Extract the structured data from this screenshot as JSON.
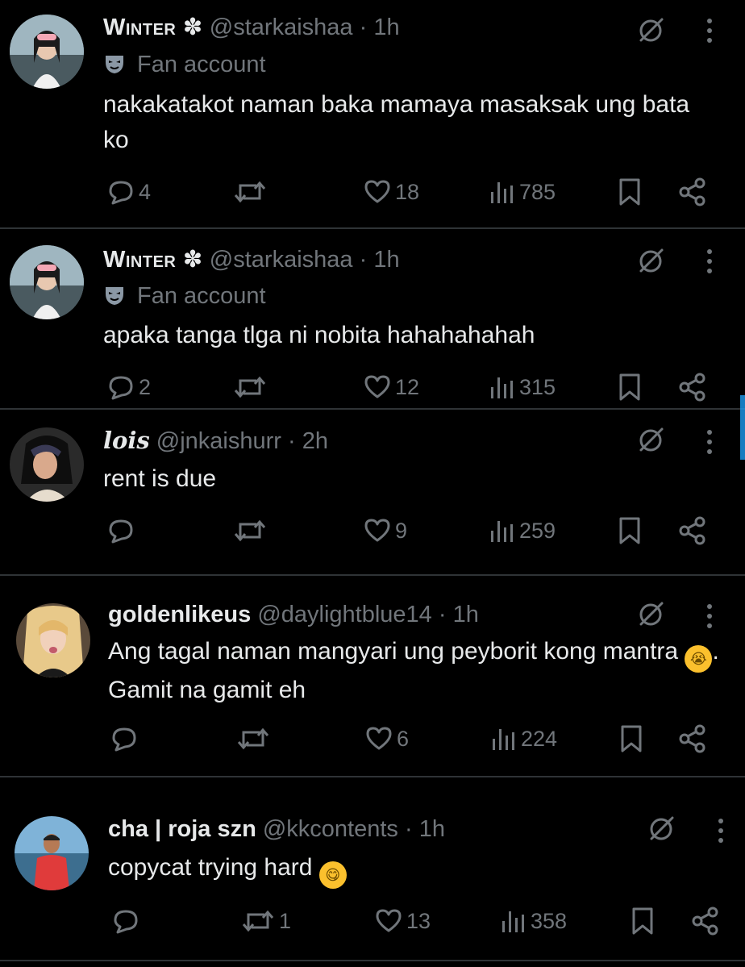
{
  "posts": [
    {
      "display_name": "Winter ✽",
      "handle": "@starkaishaa",
      "separator": "·",
      "time": "1h",
      "account_label": "Fan account",
      "text": "nakakatakot naman baka mamaya masaksak ung bata ko",
      "replies": "4",
      "reposts": "",
      "likes": "18",
      "views": "785"
    },
    {
      "display_name": "Winter ✽",
      "handle": "@starkaishaa",
      "separator": "·",
      "time": "1h",
      "account_label": "Fan account",
      "text": "apaka tanga tlga ni nobita hahahahahah",
      "replies": "2",
      "reposts": "",
      "likes": "12",
      "views": "315"
    },
    {
      "display_name": "lois",
      "handle": "@jnkaishurr",
      "separator": "·",
      "time": "2h",
      "text": "rent is due",
      "replies": "",
      "reposts": "",
      "likes": "9",
      "views": "259"
    },
    {
      "display_name": "goldenlikeus",
      "handle": "@daylightblue14",
      "separator": "·",
      "time": "1h",
      "text_before_emoji": "Ang tagal naman mangyari ung peyborit kong mantra ",
      "emoji": "loudly-crying-face",
      "text_after_emoji": ". Gamit na gamit eh",
      "replies": "",
      "reposts": "",
      "likes": "6",
      "views": "224"
    },
    {
      "display_name": "cha | roja szn",
      "handle": "@kkcontents",
      "separator": "·",
      "time": "1h",
      "text": "copycat trying hard ",
      "emoji": "face-savoring-food",
      "replies": "",
      "reposts": "1",
      "likes": "13",
      "views": "358"
    }
  ],
  "colors": {
    "background": "#000000",
    "text_primary": "#e7e9ea",
    "text_secondary": "#71767b",
    "divider": "#2f3336",
    "scroll_accent": "#1d9bf0"
  },
  "icons": [
    "reply-icon",
    "repost-icon",
    "like-icon",
    "views-icon",
    "bookmark-icon",
    "share-icon",
    "grok-icon",
    "more-icon",
    "fan-account-mask-icon"
  ]
}
